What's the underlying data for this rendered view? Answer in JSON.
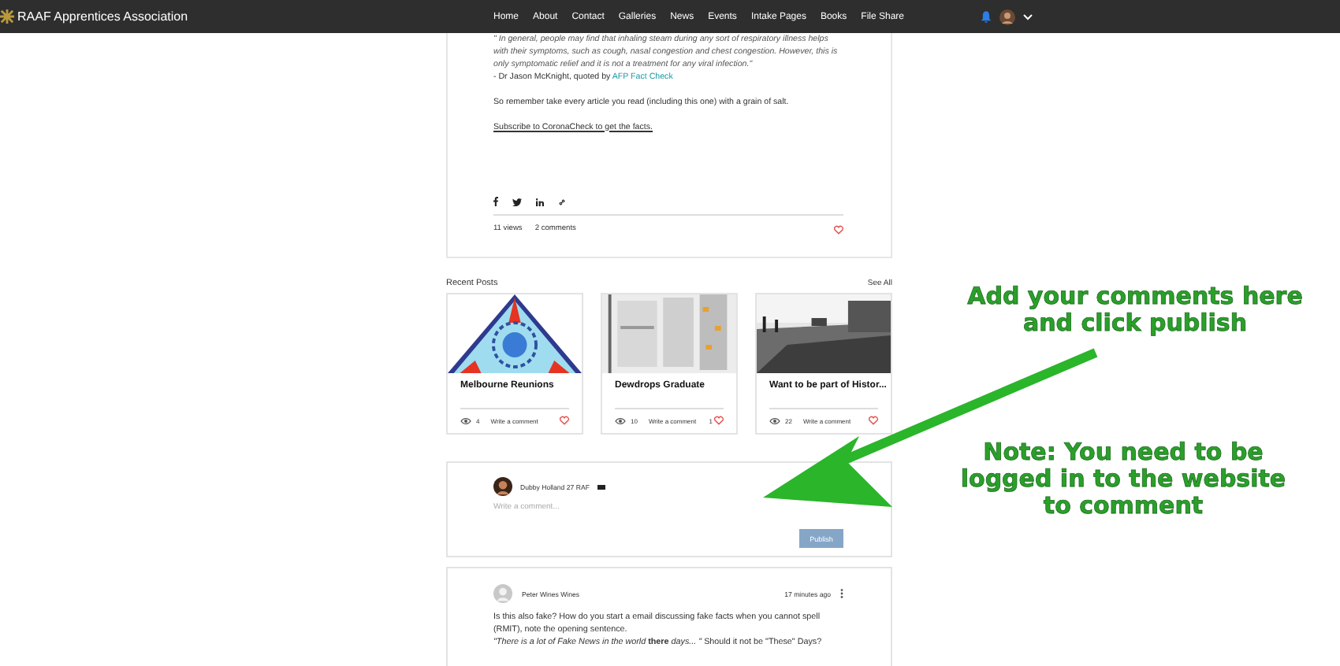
{
  "header": {
    "site_name": "RAAF Apprentices Association",
    "nav": [
      {
        "label": "Home"
      },
      {
        "label": "About"
      },
      {
        "label": "Contact"
      },
      {
        "label": "Galleries"
      },
      {
        "label": "News"
      },
      {
        "label": "Events"
      },
      {
        "label": "Intake Pages"
      },
      {
        "label": "Books"
      },
      {
        "label": "File Share"
      }
    ]
  },
  "article": {
    "quote": "\" In general, people may find that inhaling steam during any sort of respiratory illness helps with their symptoms, such as cough, nasal congestion and chest congestion. However, this is only symptomatic relief and it is not a treatment for any viral infection.\"",
    "attribution": "- Dr Jason McKnight, quoted by ",
    "attribution_link": "AFP Fact Check",
    "paragraph": "So remember take every article you read (including this one) with a grain of salt.",
    "subscribe_link": "Subscribe to CoronaCheck to get the facts.",
    "views": "11 views",
    "comments": "2 comments",
    "liked": false
  },
  "recent_posts": {
    "title": "Recent Posts",
    "see_all": "See All",
    "posts": [
      {
        "kind": "picture",
        "title": "Melbourne Reunions",
        "views": "4",
        "comment_link": "Write a comment",
        "liked": false
      },
      {
        "kind": "picture",
        "title": "Dewdrops Graduate",
        "views": "10",
        "comment_link": "Write a comment",
        "likes": "1",
        "liked": false
      },
      {
        "kind": "picture",
        "title": "Want to be part of Histor...",
        "views": "22",
        "comment_link": "Write a comment",
        "liked": false
      }
    ]
  },
  "comment_box": {
    "user": "Dubby Holland 27 RAF",
    "placeholder": "Write a comment...",
    "button": "Publish"
  },
  "comments": [
    {
      "author": "Peter Wines Wines",
      "time": "17 minutes ago",
      "text": "Is this also fake? How do you start a email discussing fake facts when you cannot spell (RMIT), note the opening sentence.",
      "quote": "*\"There is a lot of Fake News in the world* **there** *days... \"* Should it not be \"These\" Days?"
    }
  ],
  "annotations": [
    {
      "text": "Add your comments here and click publish",
      "color": "#2aa02a"
    },
    {
      "text": "Note: You need to be logged in to the website to comment",
      "color": "#2aa02a"
    }
  ]
}
